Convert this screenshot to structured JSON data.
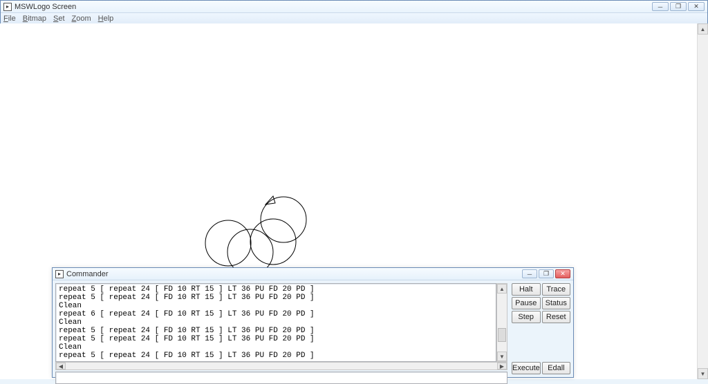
{
  "window": {
    "title": "MSWLogo Screen",
    "controls": {
      "min": "─",
      "max": "❐",
      "close": "✕"
    }
  },
  "menu": {
    "file": "File",
    "bitmap": "Bitmap",
    "set": "Set",
    "zoom": "Zoom",
    "help": "Help"
  },
  "commander": {
    "title": "Commander",
    "controls": {
      "min": "─",
      "max": "❐",
      "close": "✕"
    },
    "history": [
      "repeat 5 [ repeat 24 [ FD 10 RT 15 ] LT 36 PU FD 20 PD ]",
      "repeat 5 [ repeat 24 [ FD 10 RT 15 ] LT 36 PU FD 20 PD ]",
      "Clean",
      "repeat 6 [ repeat 24 [ FD 10 RT 15 ] LT 36 PU FD 20 PD ]",
      "Clean",
      "repeat 5 [ repeat 24 [ FD 10 RT 15 ] LT 36 PU FD 20 PD ]",
      "repeat 5 [ repeat 24 [ FD 10 RT 15 ] LT 36 PU FD 20 PD ]",
      "Clean",
      "repeat 5 [ repeat 24 [ FD 10 RT 15 ] LT 36 PU FD 20 PD ]"
    ],
    "input_value": "",
    "buttons": {
      "halt": "Halt",
      "trace": "Trace",
      "pause": "Pause",
      "status": "Status",
      "step": "Step",
      "reset": "Reset",
      "execute": "Execute",
      "edall": "Edall"
    }
  },
  "scroll": {
    "up": "▲",
    "down": "▼",
    "left": "◀",
    "right": "▶"
  }
}
